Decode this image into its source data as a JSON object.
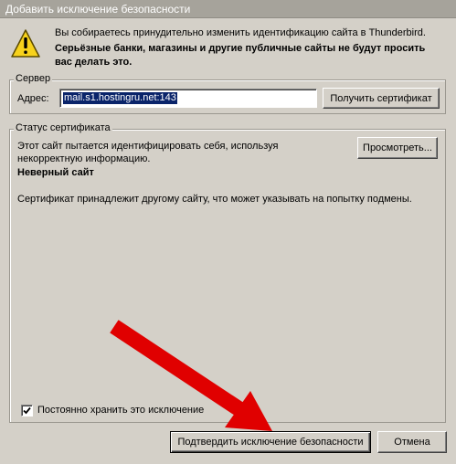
{
  "window": {
    "title": "Добавить исключение безопасности"
  },
  "warning": {
    "line1": "Вы собираетесь принудительно изменить идентификацию сайта в Thunderbird.",
    "line2": "Серьёзные банки, магазины и другие публичные сайты не будут просить вас делать это."
  },
  "server": {
    "group_label": "Сервер",
    "address_label": "Адрес:",
    "address_value": "mail.s1.hostingru.net:143",
    "get_cert_label": "Получить сертификат"
  },
  "status": {
    "group_label": "Статус сертификата",
    "text1": "Этот сайт пытается идентифицировать себя, используя некорректную информацию.",
    "view_label": "Просмотреть...",
    "wrong_site": "Неверный сайт",
    "text2": "Сертификат принадлежит другому сайту, что может указывать на попытку подмены.",
    "permanent_label": "Постоянно хранить это исключение",
    "permanent_checked": true
  },
  "actions": {
    "confirm_label": "Подтвердить исключение безопасности",
    "cancel_label": "Отмена"
  },
  "colors": {
    "arrow": "#e00000",
    "selection": "#0a246a",
    "dialog_bg": "#d4d0c8"
  },
  "icons": {
    "warning": "warning-triangle-icon",
    "check": "checkmark-icon",
    "arrow": "red-arrow-annotation"
  }
}
